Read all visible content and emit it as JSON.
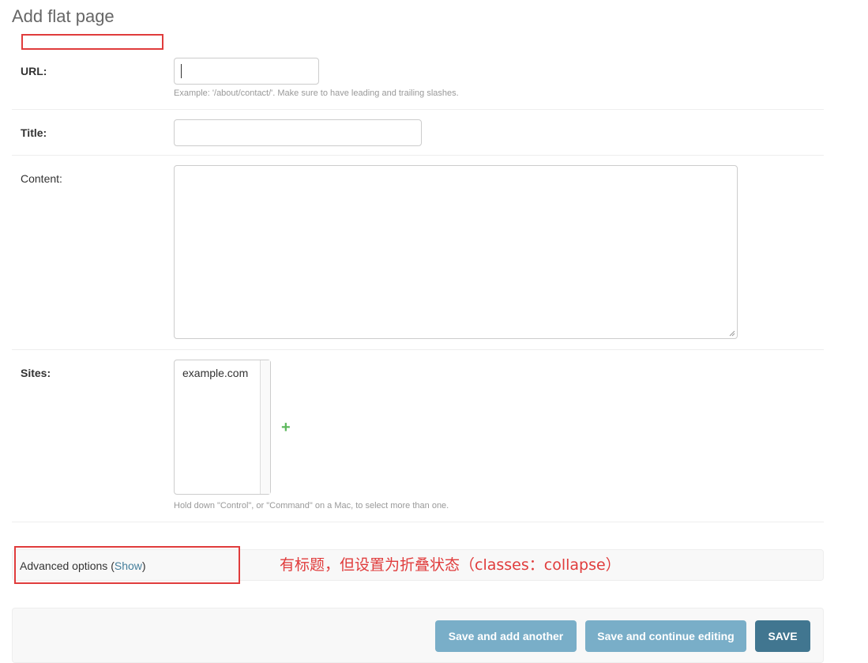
{
  "page": {
    "title": "Add flat page"
  },
  "form": {
    "url": {
      "label": "URL:",
      "value": "",
      "help": "Example: '/about/contact/'. Make sure to have leading and trailing slashes."
    },
    "title": {
      "label": "Title:",
      "value": ""
    },
    "content": {
      "label": "Content:",
      "value": ""
    },
    "sites": {
      "label": "Sites:",
      "options": [
        "example.com"
      ],
      "help": "Hold down \"Control\", or \"Command\" on a Mac, to select more than one."
    }
  },
  "advanced": {
    "label": "Advanced options (",
    "link": "Show",
    "suffix": ")"
  },
  "annotation": {
    "text": "有标题，但设置为折叠状态（classes：collapse）",
    "color": "#e03c3c"
  },
  "buttons": {
    "save_add": "Save and add another",
    "save_continue": "Save and continue editing",
    "save": "SAVE"
  },
  "colors": {
    "accent": "#417690",
    "button_light": "#79aec8",
    "add_green": "#5cb85c",
    "link": "#447e9b"
  }
}
